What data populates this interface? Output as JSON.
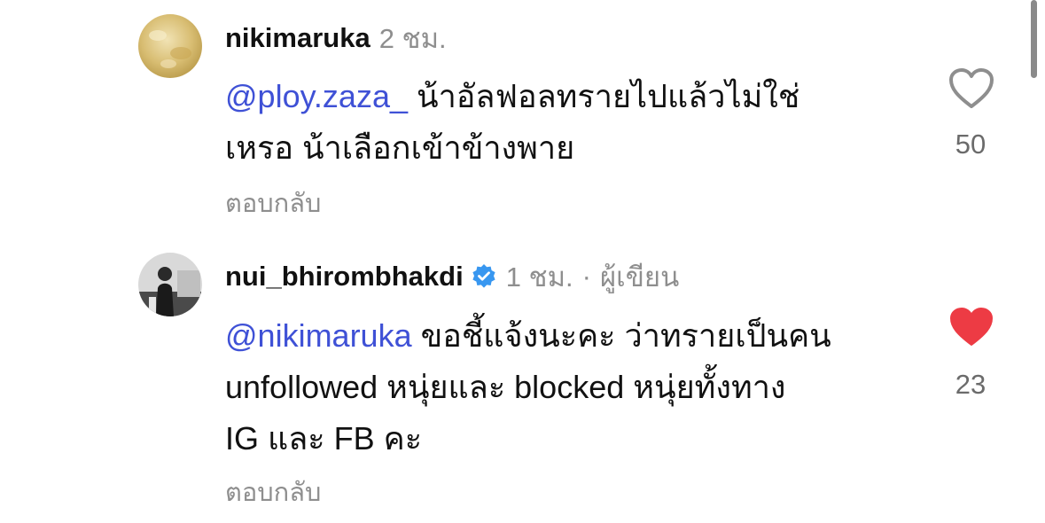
{
  "comments": [
    {
      "username": "nikimaruka",
      "time": "2 ชม.",
      "mention": "@ploy.zaza_",
      "text_line1": " น้าอัลฟอลทรายไปแล้วไม่ใช่",
      "text_line2": "เหรอ น้าเลือกเข้าข้างพาย",
      "reply_label": "ตอบกลับ",
      "likes": "50",
      "liked": false,
      "like_color": "#8e8e8e"
    },
    {
      "username": "nui_bhirombhakdi",
      "verified": true,
      "time": "1 ชม.",
      "separator": "·",
      "author_tag": "ผู้เขียน",
      "mention": "@nikimaruka",
      "text_line1": " ขอชี้แจ้งนะคะ ว่าทรายเป็นคน",
      "text_line2": "unfollowed หนุ่ยและ blocked หนุ่ยทั้งทาง",
      "text_line3": "IG และ FB คะ",
      "reply_label": "ตอบกลับ",
      "likes": "23",
      "liked": true,
      "like_color": "#ed3b44",
      "verified_color": "#3897f0"
    }
  ],
  "colors": {
    "mention": "#3f51d6",
    "secondary_text": "#8e8e8e"
  }
}
